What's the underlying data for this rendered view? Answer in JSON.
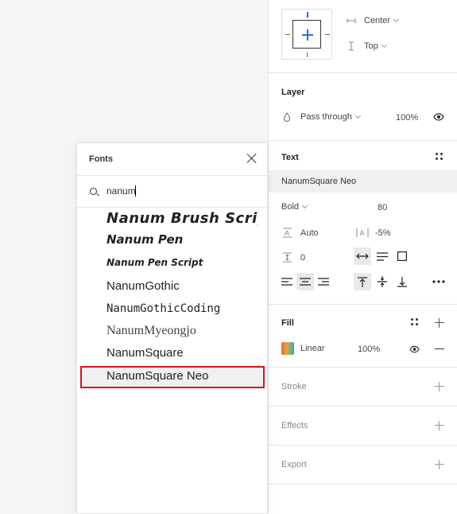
{
  "constraints": {
    "horizontal": "Center",
    "vertical": "Top"
  },
  "layer": {
    "title": "Layer",
    "blend_mode": "Pass through",
    "opacity": "100%"
  },
  "text": {
    "title": "Text",
    "font_family": "NanumSquare Neo",
    "weight": "Bold",
    "size": "80",
    "line_height": "Auto",
    "letter_spacing": "-5%",
    "paragraph_spacing": "0"
  },
  "fill": {
    "title": "Fill",
    "type": "Linear",
    "opacity": "100%"
  },
  "stroke": {
    "title": "Stroke"
  },
  "effects": {
    "title": "Effects"
  },
  "export": {
    "title": "Export"
  },
  "fonts_popup": {
    "title": "Fonts",
    "search_value": "nanum",
    "items": [
      "Nanum Brush Scrip",
      "Nanum Pen",
      "Nanum Pen Script",
      "NanumGothic",
      "NanumGothicCoding",
      "NanumMyeongjo",
      "NanumSquare",
      "NanumSquare Neo"
    ],
    "selected_index": 7
  },
  "colors": {
    "selection_outline": "#e0101a",
    "accent": "#1a73e8"
  }
}
